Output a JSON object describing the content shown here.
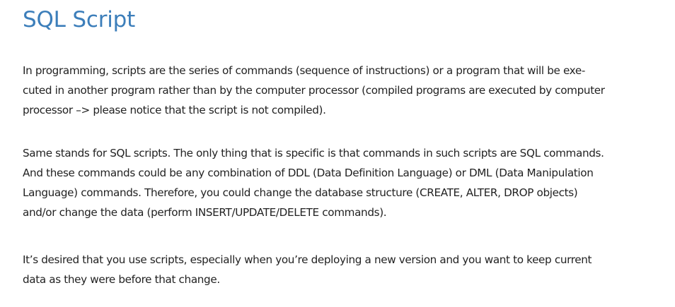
{
  "article": {
    "title": "SQL Script",
    "paragraphs": [
      "In programming, scripts are the series of commands (sequence of instructions) or a program that will be exe-\ncuted in another program rather than by the computer processor (compiled programs are executed by computer\nprocessor –> please notice that the script is not compiled).",
      "Same stands for SQL scripts. The only thing that is specific is that commands in such scripts are SQL commands.\nAnd these commands could be any combination of DDL (Data Definition Language) or DML (Data Manipulation\nLanguage) commands. Therefore, you could change the database structure (CREATE, ALTER, DROP objects)\nand/or change the data (perform INSERT/UPDATE/DELETE commands).",
      "It’s desired that you use scripts, especially when you’re deploying a new version and you want to keep current\ndata as they were before that change."
    ]
  },
  "colors": {
    "title": "#3c7eba",
    "text": "#222222",
    "background": "#ffffff"
  }
}
